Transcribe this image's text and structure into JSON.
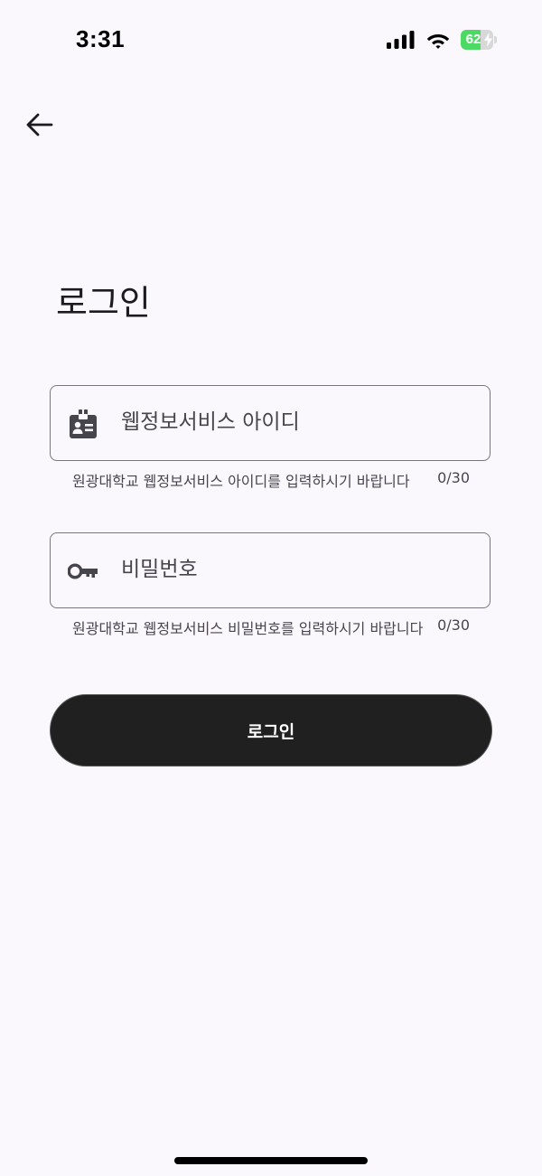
{
  "status_bar": {
    "time": "3:31",
    "battery_level": "62",
    "battery_fraction": 0.62,
    "icons": [
      "cellular-signal-icon",
      "wifi-icon",
      "battery-charging-icon"
    ]
  },
  "header": {
    "back_icon": "arrow-back-icon"
  },
  "page": {
    "title": "로그인"
  },
  "form": {
    "id_field": {
      "icon": "id-badge-icon",
      "placeholder": "웹정보서비스 아이디",
      "value": "",
      "helper_text": "원광대학교 웹정보서비스 아이디를 입력하시기 바랍니다",
      "counter": "0/30"
    },
    "password_field": {
      "icon": "key-icon",
      "placeholder": "비밀번호",
      "value": "",
      "helper_text": "원광대학교 웹정보서비스 비밀번호를 입력하시기 바랍니다",
      "counter": "0/30"
    },
    "submit_label": "로그인"
  },
  "colors": {
    "background": "#fbf8fd",
    "button": "#202020",
    "button_text": "#ffffff",
    "field_border": "#7a7680",
    "battery_fill": "#4cd964"
  }
}
